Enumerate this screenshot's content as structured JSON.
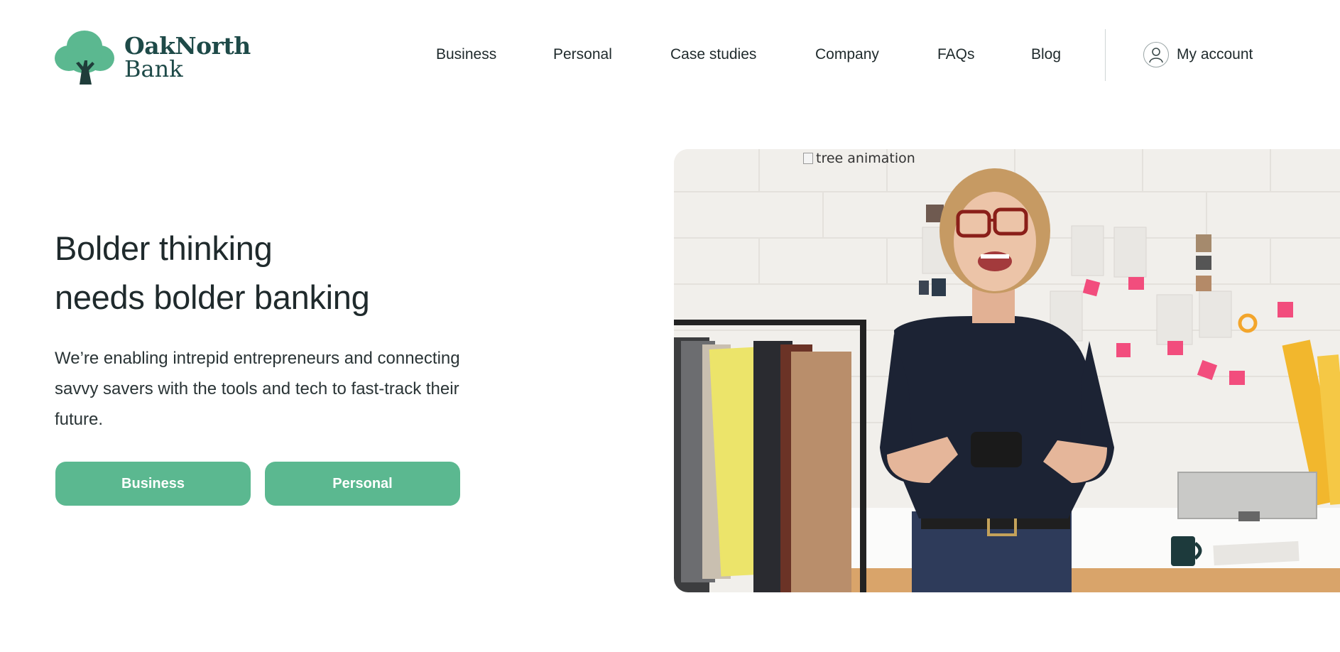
{
  "brand": {
    "name_line1": "OakNorth",
    "name_line2": "Bank",
    "primary_color": "#5bb890",
    "text_color": "#1e4a48"
  },
  "nav": {
    "items": [
      {
        "label": "Business"
      },
      {
        "label": "Personal"
      },
      {
        "label": "Case studies"
      },
      {
        "label": "Company"
      },
      {
        "label": "FAQs"
      },
      {
        "label": "Blog"
      }
    ],
    "account_label": "My account",
    "account_icon": "user-icon"
  },
  "hero": {
    "title_line1": "Bolder thinking",
    "title_line2": "needs bolder banking",
    "description": "We’re enabling intrepid entrepreneurs and connecting savvy savers with the tools and tech to fast-track their future.",
    "buttons": {
      "business": "Business",
      "personal": "Personal"
    },
    "image_alt": "tree animation"
  }
}
